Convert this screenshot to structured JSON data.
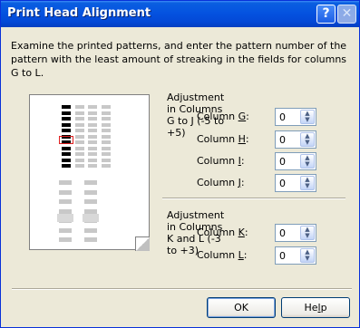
{
  "title": "Print Head Alignment",
  "title_buttons": {
    "help": "?",
    "close": "✕"
  },
  "instructions": "Examine the printed patterns, and enter the pattern number of the pattern with the least amount of streaking in the fields for columns G to L.",
  "group_gj": {
    "heading": "Adjustment in Columns G to J (-5 to +5)",
    "fields": [
      {
        "pre": "Column ",
        "key": "G",
        "post": ":",
        "value": "0"
      },
      {
        "pre": "Column ",
        "key": "H",
        "post": ":",
        "value": "0"
      },
      {
        "pre": "Column ",
        "key": "I",
        "post": ":",
        "value": "0"
      },
      {
        "pre": "Column ",
        "key": "J",
        "post": ":",
        "value": "0"
      }
    ]
  },
  "group_kl": {
    "heading": "Adjustment in Columns K and L (-3 to +3)",
    "fields": [
      {
        "pre": "Column ",
        "key": "K",
        "post": ":",
        "value": "0"
      },
      {
        "pre": "Column ",
        "key": "L",
        "post": ":",
        "value": "0"
      }
    ]
  },
  "buttons": {
    "ok": "OK",
    "help_pre": "He",
    "help_key": "l",
    "help_post": "p"
  },
  "colors": {
    "title_bar": "#0553e0",
    "dialog": "#ece9d8",
    "highlight": "#e02020"
  },
  "icons": {
    "spin_up": "▲",
    "spin_down": "▼"
  }
}
